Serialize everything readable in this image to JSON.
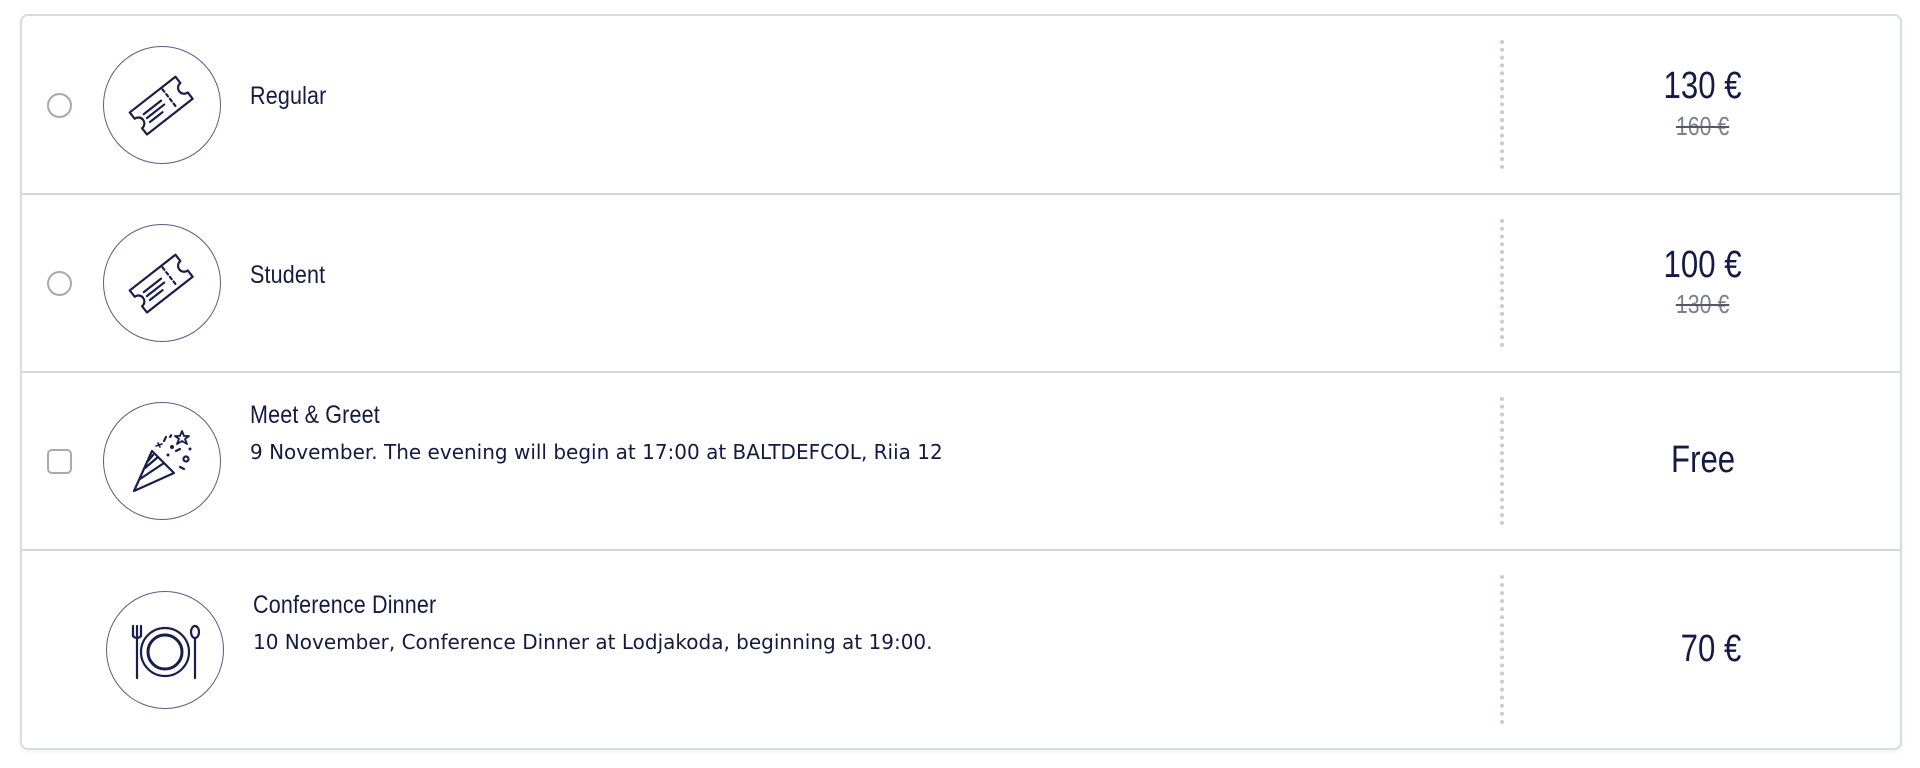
{
  "tickets": [
    {
      "title": "Regular",
      "price": "130 €",
      "old_price": "160 €",
      "control": "radio",
      "icon": "ticket-icon"
    },
    {
      "title": "Student",
      "price": "100 €",
      "old_price": "130 €",
      "control": "radio",
      "icon": "ticket-icon"
    },
    {
      "title": "Meet & Greet",
      "description": "9 November. The evening will begin at 17:00 at BALTDEFCOL, Riia 12",
      "price": "Free",
      "control": "checkbox",
      "icon": "party-popper-icon"
    },
    {
      "title": "Conference Dinner",
      "description": "10 November, Conference Dinner at Lodjakoda, beginning at 19:00.",
      "price": "70 €",
      "control": "none",
      "icon": "dinner-plate-icon"
    }
  ],
  "colors": {
    "text": "#131a44",
    "old_price": "#7d7f8c",
    "border": "#d9dbe3",
    "control_border": "#a7a9b4",
    "divider": "#c9cbd3"
  }
}
